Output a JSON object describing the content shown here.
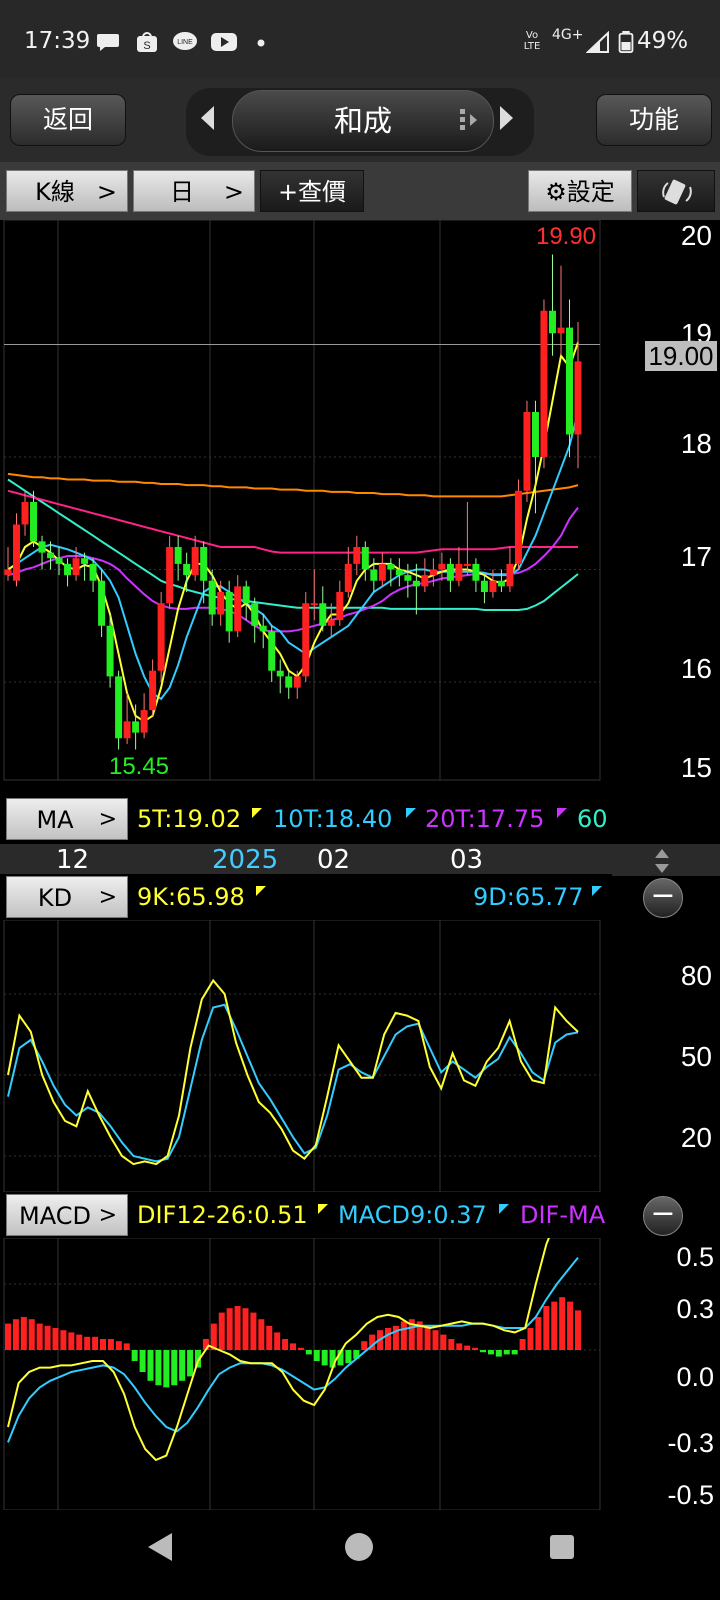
{
  "status": {
    "time": "17:39",
    "network": "4G+",
    "volte": "Vo LTE",
    "battery": "49%"
  },
  "header": {
    "back_label": "返回",
    "title": "和成",
    "function_label": "功能"
  },
  "toolbar": {
    "chart_type": "K線",
    "period": "日",
    "add_quote": "+查價",
    "settings": "⚙設定"
  },
  "main_chart": {
    "y_ticks": [
      "20",
      "19",
      "18",
      "17",
      "16",
      "15"
    ],
    "current_price": "19.00",
    "high_label": "19.90",
    "low_label": "15.45"
  },
  "ma_bar": {
    "label": "MA",
    "ma5": "5T:19.02",
    "ma10": "10T:18.40",
    "ma20": "20T:17.75",
    "ma60": "60"
  },
  "date_axis": {
    "labels": [
      "12",
      "2025",
      "02",
      "03"
    ]
  },
  "kd_bar": {
    "label": "KD",
    "k": "9K:65.98",
    "d": "9D:65.77",
    "y_ticks": [
      "80",
      "50",
      "20"
    ]
  },
  "macd_bar": {
    "label": "MACD",
    "dif": "DIF12-26:0.51",
    "macd": "MACD9:0.37",
    "osc": "DIF-MA",
    "y_ticks": [
      "0.5",
      "0.3",
      "0.0",
      "-0.3",
      "-0.5"
    ]
  },
  "colors": {
    "up": "#ff2020",
    "down": "#22ee22",
    "ma5": "#ffff33",
    "ma10": "#33ccff",
    "ma20": "#cc33ff",
    "ma60": "#ff2288",
    "ma120": "#ff8800",
    "ma240": "#33eecc"
  },
  "chart_data": [
    {
      "type": "candlestick",
      "name": "price",
      "ylim": [
        15,
        20
      ],
      "candles": [
        [
          16.95,
          17.0,
          16.9,
          17.2
        ],
        [
          16.9,
          17.4,
          16.85,
          17.5
        ],
        [
          17.4,
          17.6,
          17.3,
          17.7
        ],
        [
          17.6,
          17.25,
          17.2,
          17.7
        ],
        [
          17.25,
          17.15,
          17.0,
          17.3
        ],
        [
          17.15,
          17.1,
          17.0,
          17.25
        ],
        [
          17.1,
          17.05,
          16.95,
          17.2
        ],
        [
          17.05,
          16.95,
          16.85,
          17.1
        ],
        [
          16.95,
          17.1,
          16.9,
          17.2
        ],
        [
          17.1,
          17.05,
          16.9,
          17.15
        ],
        [
          17.05,
          16.9,
          16.8,
          17.1
        ],
        [
          16.9,
          16.5,
          16.4,
          17.0
        ],
        [
          16.5,
          16.05,
          15.95,
          16.6
        ],
        [
          16.05,
          15.5,
          15.4,
          16.1
        ],
        [
          15.5,
          15.65,
          15.45,
          15.9
        ],
        [
          15.65,
          15.55,
          15.4,
          15.8
        ],
        [
          15.55,
          15.75,
          15.5,
          15.9
        ],
        [
          15.75,
          16.1,
          15.7,
          16.2
        ],
        [
          16.1,
          16.7,
          16.0,
          16.8
        ],
        [
          16.7,
          17.2,
          16.65,
          17.3
        ],
        [
          17.2,
          17.05,
          16.9,
          17.3
        ],
        [
          17.05,
          16.95,
          16.8,
          17.15
        ],
        [
          16.95,
          17.2,
          16.9,
          17.3
        ],
        [
          17.2,
          16.9,
          16.7,
          17.25
        ],
        [
          16.9,
          16.6,
          16.5,
          17.0
        ],
        [
          16.6,
          16.8,
          16.5,
          16.9
        ],
        [
          16.8,
          16.45,
          16.35,
          16.9
        ],
        [
          16.45,
          16.85,
          16.4,
          16.95
        ],
        [
          16.85,
          16.7,
          16.55,
          16.9
        ],
        [
          16.7,
          16.5,
          16.35,
          16.75
        ],
        [
          16.5,
          16.45,
          16.3,
          16.6
        ],
        [
          16.45,
          16.1,
          16.0,
          16.5
        ],
        [
          16.1,
          16.05,
          15.9,
          16.2
        ],
        [
          16.05,
          15.95,
          15.85,
          16.1
        ],
        [
          15.95,
          16.05,
          15.85,
          16.1
        ],
        [
          16.05,
          16.7,
          16.0,
          16.8
        ],
        [
          16.7,
          16.7,
          16.55,
          17.0
        ],
        [
          16.7,
          16.5,
          16.45,
          16.85
        ],
        [
          16.5,
          16.55,
          16.4,
          16.7
        ],
        [
          16.55,
          16.8,
          16.5,
          16.9
        ],
        [
          16.8,
          17.05,
          16.75,
          17.2
        ],
        [
          17.05,
          17.2,
          16.95,
          17.3
        ],
        [
          17.2,
          17.0,
          16.9,
          17.25
        ],
        [
          17.0,
          16.9,
          16.8,
          17.1
        ],
        [
          16.9,
          17.05,
          16.85,
          17.15
        ],
        [
          17.05,
          17.0,
          16.85,
          17.1
        ],
        [
          17.0,
          16.95,
          16.85,
          17.1
        ],
        [
          16.95,
          16.9,
          16.75,
          17.05
        ],
        [
          16.9,
          16.85,
          16.6,
          17.05
        ],
        [
          16.85,
          16.95,
          16.8,
          17.1
        ],
        [
          16.95,
          17.0,
          16.85,
          17.1
        ],
        [
          17.0,
          17.05,
          16.9,
          17.15
        ],
        [
          17.05,
          16.9,
          16.8,
          17.1
        ],
        [
          16.9,
          17.05,
          16.85,
          17.2
        ],
        [
          17.05,
          17.05,
          16.95,
          17.6
        ],
        [
          17.05,
          16.9,
          16.8,
          17.1
        ],
        [
          16.9,
          16.8,
          16.7,
          16.95
        ],
        [
          16.8,
          16.9,
          16.75,
          17.0
        ],
        [
          16.9,
          16.85,
          16.8,
          17.0
        ],
        [
          16.85,
          17.05,
          16.8,
          17.2
        ],
        [
          17.05,
          17.7,
          17.0,
          17.8
        ],
        [
          17.7,
          18.4,
          17.6,
          18.5
        ],
        [
          18.4,
          18.0,
          17.5,
          18.5
        ],
        [
          18.0,
          19.3,
          17.9,
          19.4
        ],
        [
          19.3,
          19.1,
          18.9,
          19.8
        ],
        [
          19.1,
          19.15,
          18.9,
          19.7
        ],
        [
          19.15,
          18.2,
          18.0,
          19.4
        ],
        [
          18.2,
          18.85,
          17.9,
          19.2
        ]
      ],
      "ma5": [
        17.0,
        17.05,
        17.2,
        17.25,
        17.2,
        17.15,
        17.08,
        17.02,
        17.0,
        17.04,
        17.02,
        16.85,
        16.6,
        16.25,
        15.9,
        15.7,
        15.65,
        15.7,
        15.95,
        16.3,
        16.65,
        16.9,
        17.05,
        17.05,
        16.95,
        16.8,
        16.7,
        16.65,
        16.7,
        16.6,
        16.45,
        16.35,
        16.25,
        16.1,
        16.05,
        16.15,
        16.35,
        16.5,
        16.6,
        16.6,
        16.7,
        16.9,
        17.0,
        17.05,
        17.05,
        17.05,
        17.0,
        16.98,
        16.95,
        16.92,
        16.95,
        16.98,
        17.0,
        17.0,
        17.0,
        16.98,
        16.95,
        16.9,
        16.88,
        16.92,
        17.1,
        17.45,
        17.75,
        18.1,
        18.5,
        18.9,
        18.8,
        19.02
      ],
      "ma10": [
        17.0,
        17.05,
        17.1,
        17.15,
        17.2,
        17.22,
        17.2,
        17.18,
        17.15,
        17.12,
        17.08,
        17.0,
        16.9,
        16.75,
        16.5,
        16.25,
        16.05,
        15.9,
        15.85,
        15.95,
        16.15,
        16.4,
        16.6,
        16.8,
        16.85,
        16.85,
        16.8,
        16.75,
        16.7,
        16.65,
        16.6,
        16.5,
        16.45,
        16.35,
        16.3,
        16.25,
        16.3,
        16.35,
        16.4,
        16.45,
        16.5,
        16.6,
        16.7,
        16.8,
        16.85,
        16.9,
        16.95,
        16.98,
        17.0,
        17.0,
        16.98,
        16.98,
        16.98,
        16.98,
        16.98,
        16.98,
        16.97,
        16.95,
        16.95,
        16.95,
        17.0,
        17.15,
        17.3,
        17.5,
        17.7,
        17.9,
        18.1,
        18.4
      ],
      "ma20": [
        16.95,
        16.97,
        17.0,
        17.02,
        17.05,
        17.08,
        17.1,
        17.12,
        17.12,
        17.12,
        17.1,
        17.08,
        17.05,
        17.0,
        16.92,
        16.85,
        16.78,
        16.72,
        16.68,
        16.66,
        16.65,
        16.65,
        16.66,
        16.66,
        16.66,
        16.65,
        16.63,
        16.6,
        16.55,
        16.5,
        16.46,
        16.45,
        16.45,
        16.45,
        16.46,
        16.48,
        16.5,
        16.52,
        16.55,
        16.57,
        16.6,
        16.62,
        16.65,
        16.68,
        16.72,
        16.78,
        16.82,
        16.85,
        16.87,
        16.88,
        16.9,
        16.92,
        16.93,
        16.94,
        16.95,
        16.96,
        16.96,
        16.96,
        16.96,
        16.96,
        16.97,
        17.0,
        17.05,
        17.12,
        17.2,
        17.3,
        17.45,
        17.55
      ],
      "ma60": [
        17.7,
        17.68,
        17.66,
        17.64,
        17.62,
        17.6,
        17.58,
        17.56,
        17.54,
        17.52,
        17.5,
        17.48,
        17.46,
        17.44,
        17.42,
        17.4,
        17.38,
        17.36,
        17.34,
        17.32,
        17.3,
        17.28,
        17.26,
        17.24,
        17.22,
        17.2,
        17.2,
        17.2,
        17.2,
        17.2,
        17.18,
        17.16,
        17.15,
        17.15,
        17.15,
        17.15,
        17.15,
        17.15,
        17.15,
        17.15,
        17.15,
        17.15,
        17.15,
        17.15,
        17.15,
        17.15,
        17.15,
        17.15,
        17.15,
        17.16,
        17.17,
        17.18,
        17.18,
        17.18,
        17.18,
        17.18,
        17.18,
        17.18,
        17.19,
        17.2,
        17.2,
        17.2,
        17.2,
        17.2,
        17.2,
        17.2,
        17.2,
        17.2
      ],
      "ma120": [
        17.85,
        17.84,
        17.83,
        17.82,
        17.82,
        17.81,
        17.81,
        17.8,
        17.8,
        17.8,
        17.79,
        17.79,
        17.79,
        17.78,
        17.78,
        17.78,
        17.77,
        17.77,
        17.76,
        17.76,
        17.76,
        17.75,
        17.75,
        17.75,
        17.74,
        17.74,
        17.73,
        17.73,
        17.73,
        17.72,
        17.72,
        17.72,
        17.71,
        17.71,
        17.71,
        17.7,
        17.7,
        17.7,
        17.69,
        17.69,
        17.69,
        17.68,
        17.68,
        17.68,
        17.67,
        17.67,
        17.67,
        17.66,
        17.66,
        17.66,
        17.65,
        17.65,
        17.65,
        17.65,
        17.65,
        17.65,
        17.65,
        17.65,
        17.65,
        17.66,
        17.67,
        17.68,
        17.69,
        17.7,
        17.71,
        17.72,
        17.73,
        17.75
      ],
      "ma240": [
        17.8,
        17.75,
        17.7,
        17.65,
        17.6,
        17.55,
        17.5,
        17.45,
        17.4,
        17.35,
        17.3,
        17.25,
        17.2,
        17.15,
        17.1,
        17.05,
        17.0,
        16.95,
        16.9,
        16.87,
        16.85,
        16.82,
        16.8,
        16.78,
        16.76,
        16.75,
        16.74,
        16.73,
        16.72,
        16.71,
        16.7,
        16.69,
        16.68,
        16.67,
        16.66,
        16.66,
        16.66,
        16.66,
        16.66,
        16.66,
        16.66,
        16.66,
        16.66,
        16.66,
        16.66,
        16.65,
        16.65,
        16.65,
        16.65,
        16.65,
        16.65,
        16.65,
        16.65,
        16.65,
        16.65,
        16.65,
        16.64,
        16.64,
        16.64,
        16.64,
        16.64,
        16.65,
        16.68,
        16.72,
        16.78,
        16.84,
        16.9,
        16.96
      ]
    },
    {
      "type": "line",
      "name": "KD",
      "ylim": [
        0,
        100
      ],
      "k": [
        50,
        72,
        66,
        50,
        40,
        33,
        31,
        44,
        35,
        27,
        20,
        17,
        18,
        17,
        20,
        35,
        60,
        78,
        85,
        80,
        62,
        50,
        40,
        36,
        30,
        22,
        19,
        24,
        42,
        61,
        55,
        49,
        49,
        65,
        73,
        72,
        70,
        53,
        45,
        58,
        48,
        46,
        55,
        60,
        70,
        55,
        48,
        47,
        75,
        70,
        65.98
      ],
      "d": [
        42,
        60,
        63,
        55,
        46,
        39,
        35,
        38,
        36,
        31,
        25,
        20,
        19,
        18,
        19,
        27,
        45,
        63,
        75,
        76,
        67,
        57,
        47,
        41,
        34,
        27,
        21,
        23,
        35,
        52,
        54,
        51,
        49,
        57,
        65,
        68,
        69,
        60,
        51,
        55,
        52,
        49,
        53,
        56,
        64,
        58,
        51,
        48,
        62,
        65,
        65.77
      ]
    },
    {
      "type": "bar",
      "name": "MACD",
      "ylim": [
        -0.58,
        0.64
      ],
      "osc": [
        0.12,
        0.14,
        0.15,
        0.14,
        0.12,
        0.11,
        0.1,
        0.09,
        0.08,
        0.07,
        0.06,
        0.06,
        0.05,
        0.05,
        0.04,
        0.03,
        -0.05,
        -0.1,
        -0.14,
        -0.16,
        -0.17,
        -0.16,
        -0.14,
        -0.12,
        -0.08,
        0.05,
        0.12,
        0.17,
        0.19,
        0.2,
        0.19,
        0.17,
        0.14,
        0.11,
        0.08,
        0.05,
        0.03,
        0.01,
        -0.02,
        -0.05,
        -0.07,
        -0.08,
        -0.07,
        -0.06,
        -0.04,
        0.04,
        0.07,
        0.09,
        0.1,
        0.11,
        0.13,
        0.14,
        0.13,
        0.11,
        0.09,
        0.07,
        0.05,
        0.03,
        0.02,
        0.01,
        -0.01,
        -0.02,
        -0.03,
        -0.02,
        -0.02,
        0.05,
        0.1,
        0.15,
        0.2,
        0.22,
        0.24,
        0.22,
        0.18
      ],
      "dif": [
        -0.35,
        -0.15,
        -0.1,
        -0.08,
        -0.08,
        -0.07,
        -0.07,
        -0.06,
        -0.05,
        -0.05,
        -0.1,
        -0.2,
        -0.35,
        -0.45,
        -0.5,
        -0.48,
        -0.35,
        -0.2,
        -0.05,
        0.02,
        0.0,
        -0.02,
        -0.05,
        -0.06,
        -0.06,
        -0.06,
        -0.1,
        -0.18,
        -0.23,
        -0.25,
        -0.18,
        -0.05,
        0.03,
        0.07,
        0.12,
        0.15,
        0.16,
        0.15,
        0.12,
        0.11,
        0.1,
        0.11,
        0.12,
        0.13,
        0.12,
        0.12,
        0.11,
        0.09,
        0.08,
        0.1,
        0.3,
        0.48,
        0.6,
        0.62,
        0.6
      ],
      "dea": [
        -0.42,
        -0.3,
        -0.22,
        -0.17,
        -0.14,
        -0.12,
        -0.1,
        -0.09,
        -0.08,
        -0.07,
        -0.08,
        -0.11,
        -0.17,
        -0.24,
        -0.3,
        -0.35,
        -0.37,
        -0.33,
        -0.26,
        -0.18,
        -0.11,
        -0.08,
        -0.06,
        -0.06,
        -0.06,
        -0.07,
        -0.09,
        -0.12,
        -0.15,
        -0.18,
        -0.17,
        -0.13,
        -0.08,
        -0.04,
        0.0,
        0.04,
        0.07,
        0.09,
        0.1,
        0.11,
        0.11,
        0.11,
        0.11,
        0.11,
        0.12,
        0.12,
        0.11,
        0.1,
        0.1,
        0.1,
        0.15,
        0.23,
        0.3,
        0.36,
        0.42
      ]
    }
  ]
}
